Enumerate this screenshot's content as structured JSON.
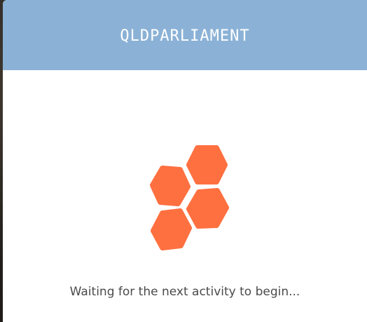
{
  "header": {
    "title": "QLDPARLIAMENT"
  },
  "status": {
    "message": "Waiting for the next activity to begin..."
  },
  "colors": {
    "header_background": "#8bb2d6",
    "loader_hexagon": "#ff7040"
  },
  "icons": {
    "loader": "hexagon-cluster-loader-icon"
  }
}
